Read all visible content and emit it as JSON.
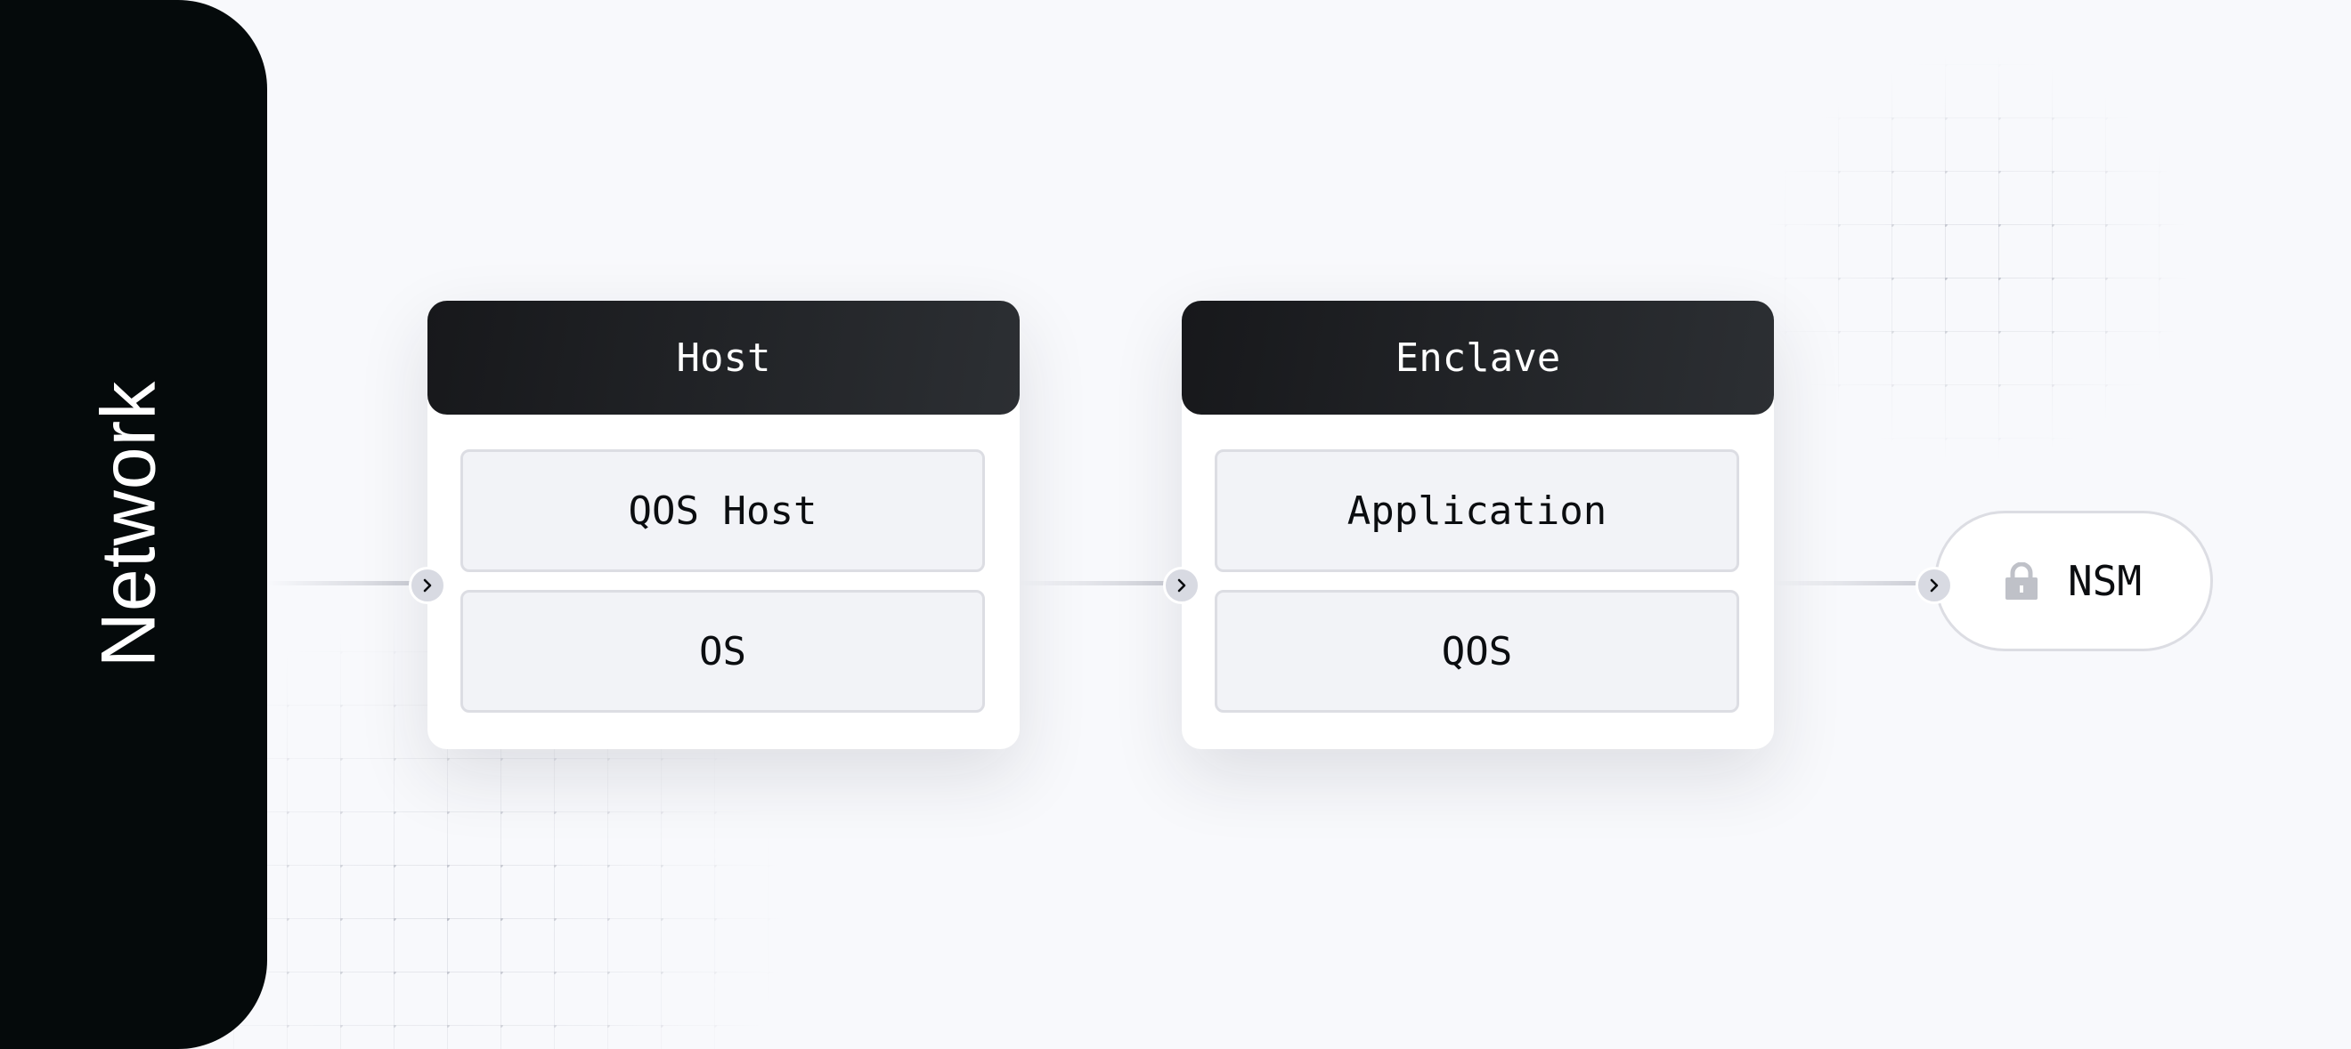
{
  "network_label": "Network",
  "nodes": [
    {
      "title": "Host",
      "items": [
        "QOS Host",
        "OS"
      ]
    },
    {
      "title": "Enclave",
      "items": [
        "Application",
        "QOS"
      ]
    }
  ],
  "nsm": {
    "label": "NSM",
    "icon": "lock-icon"
  },
  "connector_icon": "chevron-right-icon",
  "colors": {
    "panel": "#050a0b",
    "header": "#1c1d20",
    "background": "#f8f9fc",
    "item_bg": "#f2f3f7",
    "lock": "#bfc1c8"
  }
}
